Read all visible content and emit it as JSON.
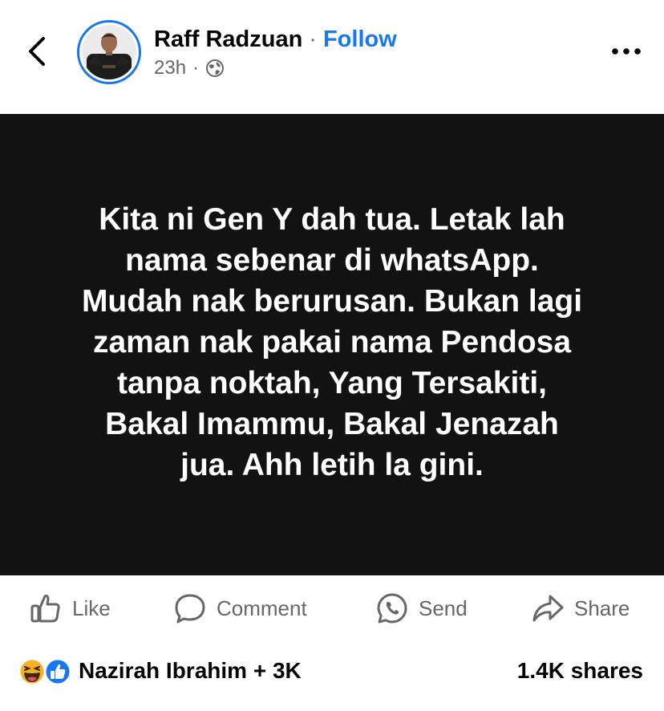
{
  "header": {
    "author": "Raff Radzuan",
    "separator": "·",
    "follow_label": "Follow",
    "timestamp": "23h",
    "meta_separator": "·",
    "audience_icon": "globe-icon",
    "back_icon": "chevron-left-icon",
    "more_icon": "more-horizontal-icon"
  },
  "post": {
    "lines": [
      "Kita ni Gen Y dah tua. Letak lah",
      "nama sebenar di whatsApp.",
      "Mudah nak berurusan. Bukan lagi",
      "zaman nak pakai nama Pendosa",
      "tanpa noktah, Yang Tersakiti,",
      "Bakal Imammu, Bakal Jenazah",
      "jua. Ahh letih la gini."
    ],
    "background_color": "#121212",
    "text_color": "#ffffff"
  },
  "actions": {
    "like": {
      "label": "Like",
      "icon": "thumbs-up-icon"
    },
    "comment": {
      "label": "Comment",
      "icon": "comment-icon"
    },
    "send": {
      "label": "Send",
      "icon": "whatsapp-icon"
    },
    "share": {
      "label": "Share",
      "icon": "share-arrow-icon"
    }
  },
  "footer": {
    "reaction_icons": [
      "haha-reaction-icon",
      "like-reaction-icon"
    ],
    "reactors": "Nazirah Ibrahim + 3K",
    "shares": "1.4K shares"
  },
  "colors": {
    "accent": "#1877f2",
    "secondary_text": "#65676b",
    "primary_text": "#050505"
  }
}
